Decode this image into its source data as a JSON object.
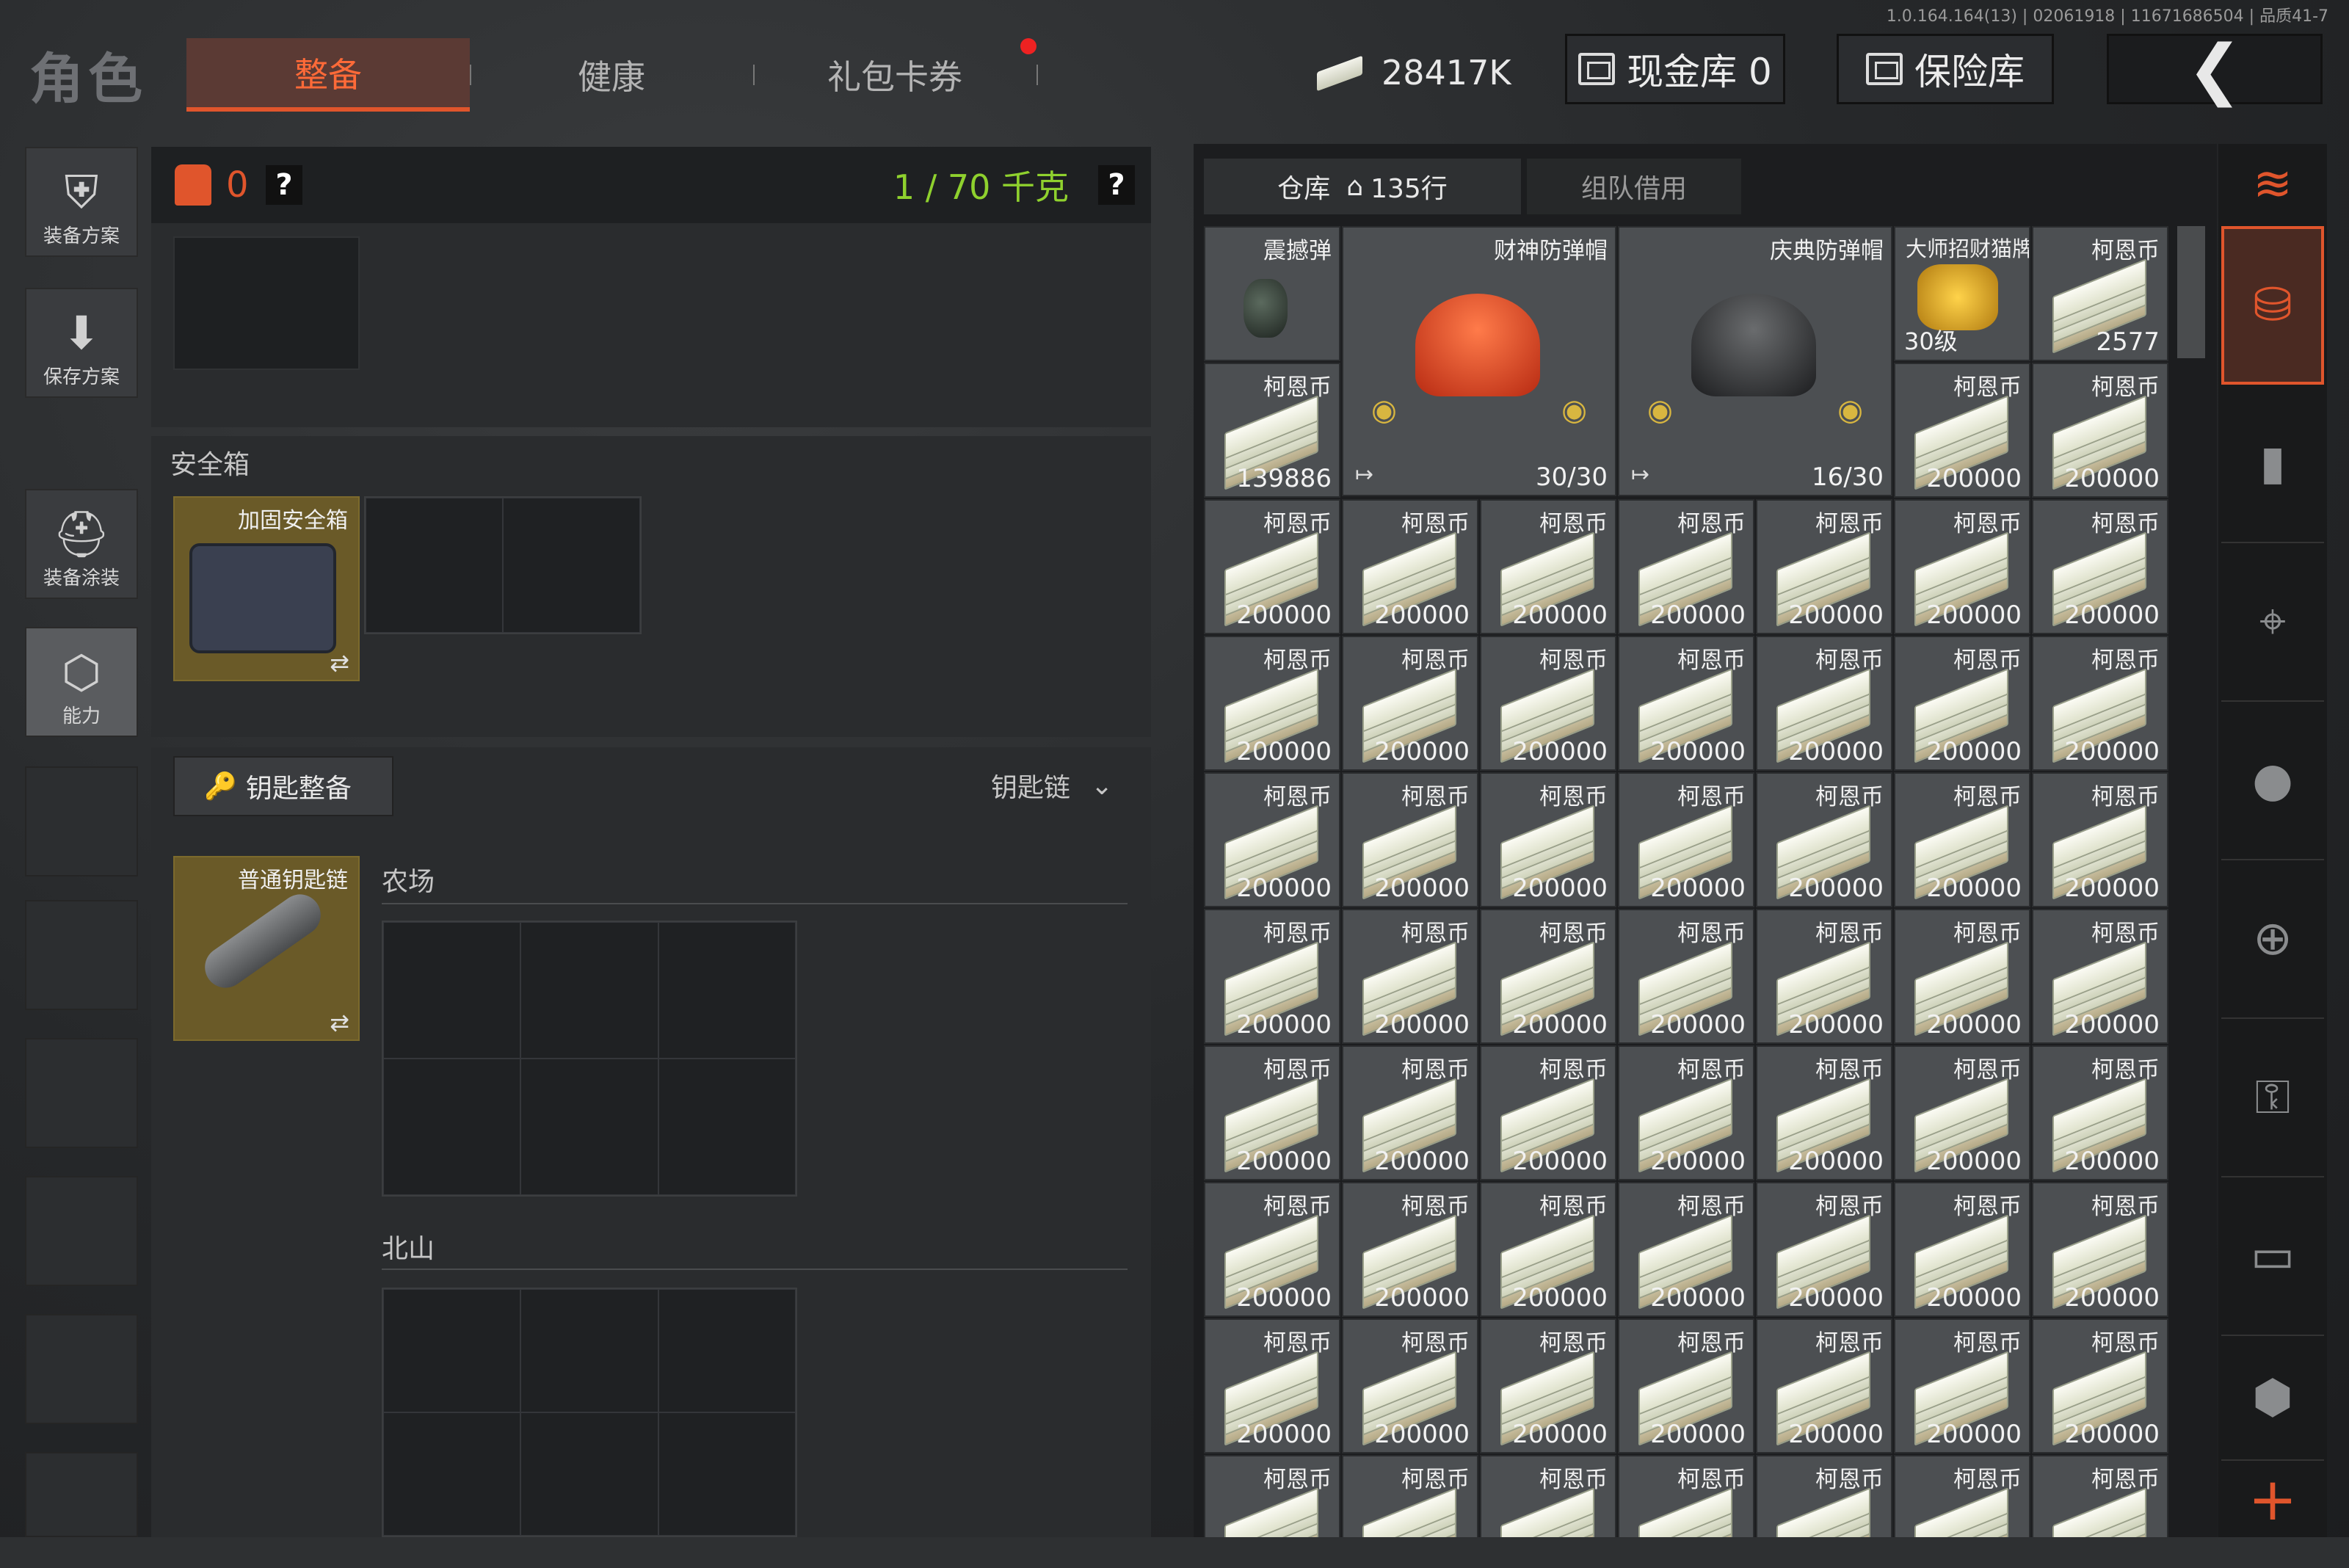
{
  "version": "1.0.164.164(13) | 02061918 | 11671686504 | 品质41-7",
  "header": {
    "title": "角色",
    "tabs": [
      "整备",
      "健康",
      "礼包卡券"
    ],
    "money": "28417K",
    "cash_vault": "现金库 0",
    "safe_vault": "保险库",
    "back_icon": "back-arrow-icon"
  },
  "sidebar": {
    "items": [
      {
        "label": "装备方案",
        "icon": "vest-icon"
      },
      {
        "label": "保存方案",
        "icon": "download-icon"
      },
      {
        "label": "装备涂装",
        "icon": "helmet-paint-icon"
      },
      {
        "label": "能力",
        "icon": "lightning-hex-icon"
      }
    ]
  },
  "loadout": {
    "armor_count": "0",
    "weight": "1 / 70 千克",
    "help": "?",
    "safe_box_label": "安全箱",
    "safe_box_item": "加固安全箱",
    "key_button": "钥匙整备",
    "key_dropdown": "钥匙链",
    "keychain_item": "普通钥匙链",
    "zones": [
      "农场",
      "北山"
    ]
  },
  "warehouse": {
    "tab_main": "仓库",
    "tab_rows": "135行",
    "tab_team": "组队借用",
    "top_items": [
      {
        "name": "震撼弹",
        "count": ""
      },
      {
        "name": "财神防弹帽",
        "count": "30/30"
      },
      {
        "name": "庆典防弹帽",
        "count": "16/30"
      },
      {
        "name": "大师招财猫牌",
        "count": "30级"
      },
      {
        "name": "柯恩币",
        "count": "2577"
      },
      {
        "name": "柯恩币",
        "count": "139886"
      }
    ],
    "cash_name": "柯恩币",
    "cash_count": "200000"
  },
  "categories": [
    "all-items-icon",
    "equipment-icon",
    "ammo-icon",
    "scope-icon",
    "grenade-icon",
    "medical-icon",
    "key-icon",
    "cash-icon",
    "container-icon",
    "add-icon"
  ],
  "colors": {
    "accent": "#e0552c",
    "weight_green": "#8fd12e",
    "gold_tile": "#6a5a28"
  }
}
